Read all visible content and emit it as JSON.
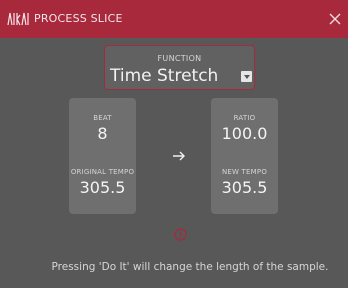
{
  "header": {
    "title": "PROCESS SLICE",
    "logo_icon": "akai-logo-icon",
    "close_icon": "close-icon",
    "accent_color": "#a8283c"
  },
  "function": {
    "label": "FUNCTION",
    "value": "Time Stretch",
    "dropdown_icon": "dropdown-arrow-icon"
  },
  "source": {
    "beat_label": "BEAT",
    "beat_value": "8",
    "original_tempo_label": "ORIGINAL TEMPO",
    "original_tempo_value": "305.5"
  },
  "target": {
    "ratio_label": "RATIO",
    "ratio_value": "100.0",
    "new_tempo_label": "NEW TEMPO",
    "new_tempo_value": "305.5"
  },
  "arrow_icon": "arrow-right-icon",
  "warning_icon": "warning-circle-icon",
  "message": "Pressing 'Do It' will change the length of the sample."
}
